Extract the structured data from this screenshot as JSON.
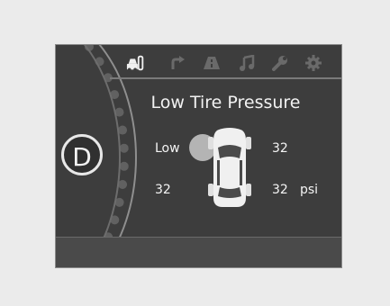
{
  "display": {
    "gear": "D",
    "title": "Low Tire Pressure",
    "tabs": [
      {
        "icon": "tire-pressure-icon",
        "active": true
      },
      {
        "icon": "turn-arrow-icon",
        "active": false
      },
      {
        "icon": "road-icon",
        "active": false
      },
      {
        "icon": "music-note-icon",
        "active": false
      },
      {
        "icon": "wrench-icon",
        "active": false
      },
      {
        "icon": "gear-icon",
        "active": false
      }
    ],
    "tires": {
      "front_left": "Low",
      "front_right": "32",
      "rear_left": "32",
      "rear_right": "32"
    },
    "unit": "psi"
  },
  "colors": {
    "screen_bg": "#3d3d3d",
    "text": "#f4f4f4",
    "inactive_icon": "#6a6a6a"
  }
}
